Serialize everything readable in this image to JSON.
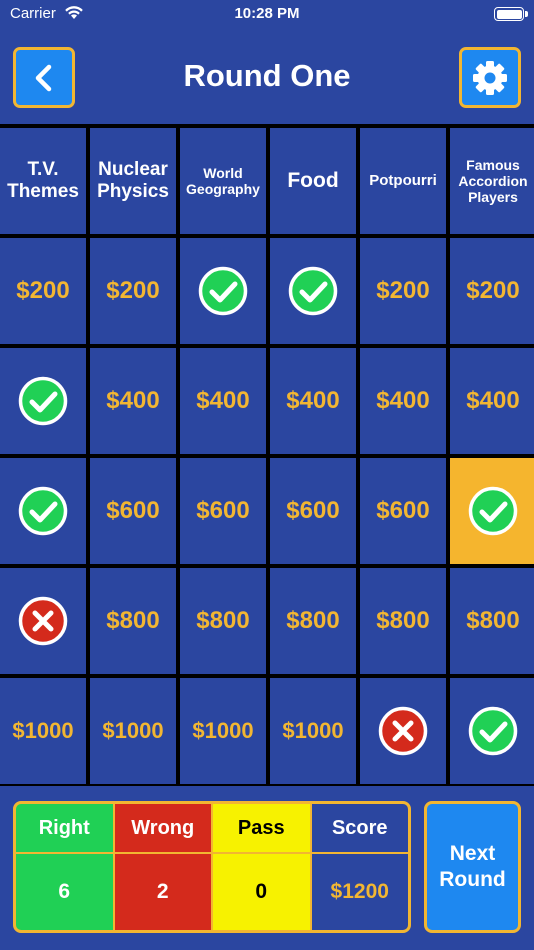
{
  "status_bar": {
    "carrier": "Carrier",
    "time": "10:28 PM"
  },
  "header": {
    "title": "Round One",
    "back_icon": "chevron-left-icon",
    "settings_icon": "gear-icon"
  },
  "categories": [
    "T.V. Themes",
    "Nuclear Physics",
    "World Geography",
    "Food",
    "Potpourri",
    "Famous Accordion Players"
  ],
  "board": [
    [
      {
        "type": "value",
        "text": "$200"
      },
      {
        "type": "value",
        "text": "$200"
      },
      {
        "type": "right"
      },
      {
        "type": "right"
      },
      {
        "type": "value",
        "text": "$200"
      },
      {
        "type": "value",
        "text": "$200"
      }
    ],
    [
      {
        "type": "right"
      },
      {
        "type": "value",
        "text": "$400"
      },
      {
        "type": "value",
        "text": "$400"
      },
      {
        "type": "value",
        "text": "$400"
      },
      {
        "type": "value",
        "text": "$400"
      },
      {
        "type": "value",
        "text": "$400"
      }
    ],
    [
      {
        "type": "right"
      },
      {
        "type": "value",
        "text": "$600"
      },
      {
        "type": "value",
        "text": "$600"
      },
      {
        "type": "value",
        "text": "$600"
      },
      {
        "type": "value",
        "text": "$600"
      },
      {
        "type": "right",
        "highlight": true
      }
    ],
    [
      {
        "type": "wrong"
      },
      {
        "type": "value",
        "text": "$800"
      },
      {
        "type": "value",
        "text": "$800"
      },
      {
        "type": "value",
        "text": "$800"
      },
      {
        "type": "value",
        "text": "$800"
      },
      {
        "type": "value",
        "text": "$800"
      }
    ],
    [
      {
        "type": "value",
        "text": "$1000"
      },
      {
        "type": "value",
        "text": "$1000"
      },
      {
        "type": "value",
        "text": "$1000"
      },
      {
        "type": "value",
        "text": "$1000"
      },
      {
        "type": "wrong"
      },
      {
        "type": "right"
      }
    ]
  ],
  "colors": {
    "background": "#2b46a0",
    "money": "#f2b632",
    "highlight": "#f5b52e",
    "right": "#20d055",
    "wrong": "#d42a1c",
    "pass": "#f7f200",
    "button": "#1e88f0"
  },
  "scoreboard": {
    "right_label": "Right",
    "right_value": "6",
    "wrong_label": "Wrong",
    "wrong_value": "2",
    "pass_label": "Pass",
    "pass_value": "0",
    "score_label": "Score",
    "score_value": "$1200"
  },
  "next_round": {
    "label_line1": "Next",
    "label_line2": "Round"
  }
}
